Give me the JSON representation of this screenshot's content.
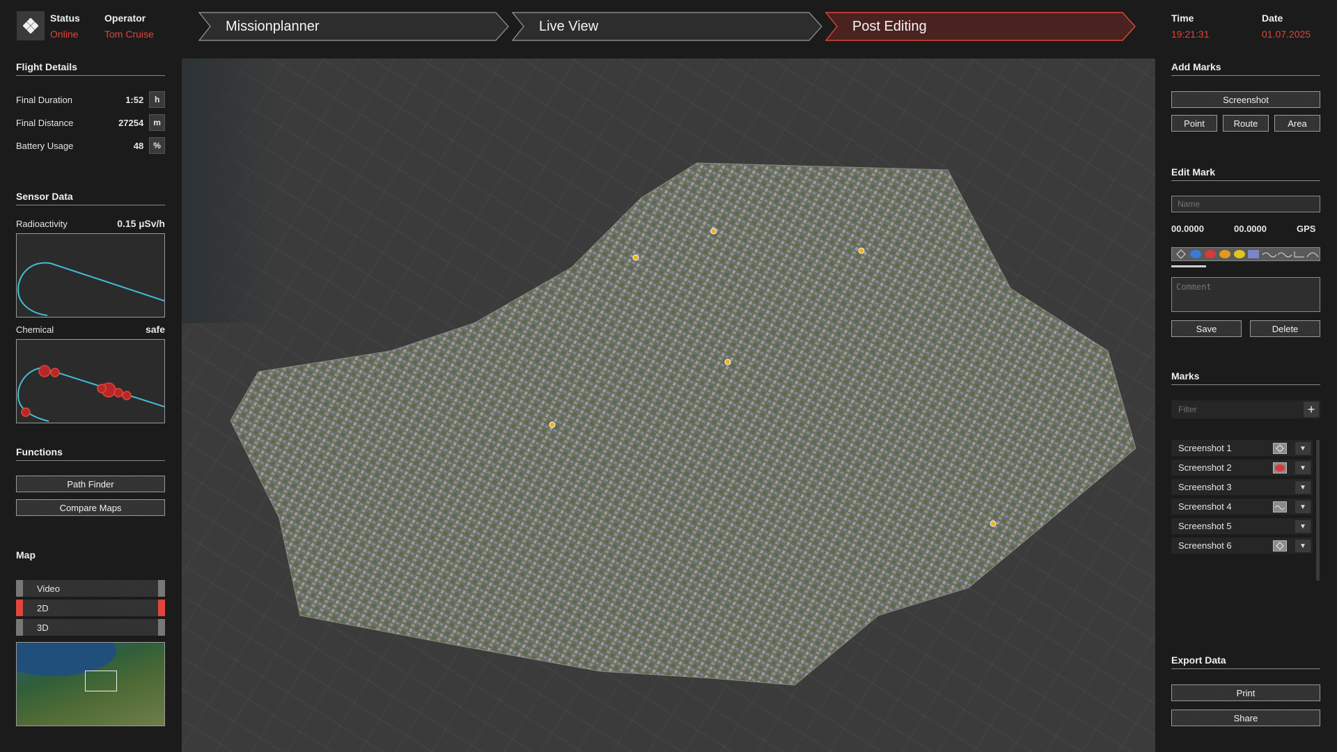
{
  "header": {
    "status_label": "Status",
    "status_value": "Online",
    "operator_label": "Operator",
    "operator_value": "Tom Cruise",
    "time_label": "Time",
    "time_value": "19:21:31",
    "date_label": "Date",
    "date_value": "01.07.2025",
    "tabs": [
      {
        "label": "Missionplanner",
        "active": false
      },
      {
        "label": "Live View",
        "active": false
      },
      {
        "label": "Post Editing",
        "active": true
      }
    ]
  },
  "flight": {
    "title": "Flight Details",
    "rows": [
      {
        "label": "Final Duration",
        "value": "1:52",
        "unit": "h"
      },
      {
        "label": "Final Distance",
        "value": "27254",
        "unit": "m"
      },
      {
        "label": "Battery Usage",
        "value": "48",
        "unit": "%"
      }
    ]
  },
  "sensor": {
    "title": "Sensor Data",
    "radio_label": "Radioactivity",
    "radio_value": "0.15 µSv/h",
    "chem_label": "Chemical",
    "chem_value": "safe"
  },
  "functions": {
    "title": "Functions",
    "path_finder": "Path Finder",
    "compare_maps": "Compare Maps"
  },
  "map_panel": {
    "title": "Map",
    "options": [
      {
        "label": "Video",
        "active": false
      },
      {
        "label": "2D",
        "active": true
      },
      {
        "label": "3D",
        "active": false
      }
    ]
  },
  "add_marks": {
    "title": "Add Marks",
    "screenshot": "Screenshot",
    "point": "Point",
    "route": "Route",
    "area": "Area"
  },
  "edit_mark": {
    "title": "Edit Mark",
    "name_placeholder": "Name",
    "lat": "00.0000",
    "lon": "00.0000",
    "gps_label": "GPS",
    "comment_placeholder": "Comment",
    "save": "Save",
    "delete": "Delete"
  },
  "marks": {
    "title": "Marks",
    "filter_placeholder": "Filter",
    "items": [
      {
        "label": "Screenshot 1",
        "icon": "diamond-icon"
      },
      {
        "label": "Screenshot 2",
        "icon": "red-blob-icon"
      },
      {
        "label": "Screenshot 3",
        "icon": ""
      },
      {
        "label": "Screenshot 4",
        "icon": "route-icon"
      },
      {
        "label": "Screenshot 5",
        "icon": ""
      },
      {
        "label": "Screenshot 6",
        "icon": "diamond-icon"
      }
    ]
  },
  "export": {
    "title": "Export Data",
    "print": "Print",
    "share": "Share"
  },
  "colors": {
    "accent": "#e0453a",
    "chart_line": "#3fc0d6"
  }
}
